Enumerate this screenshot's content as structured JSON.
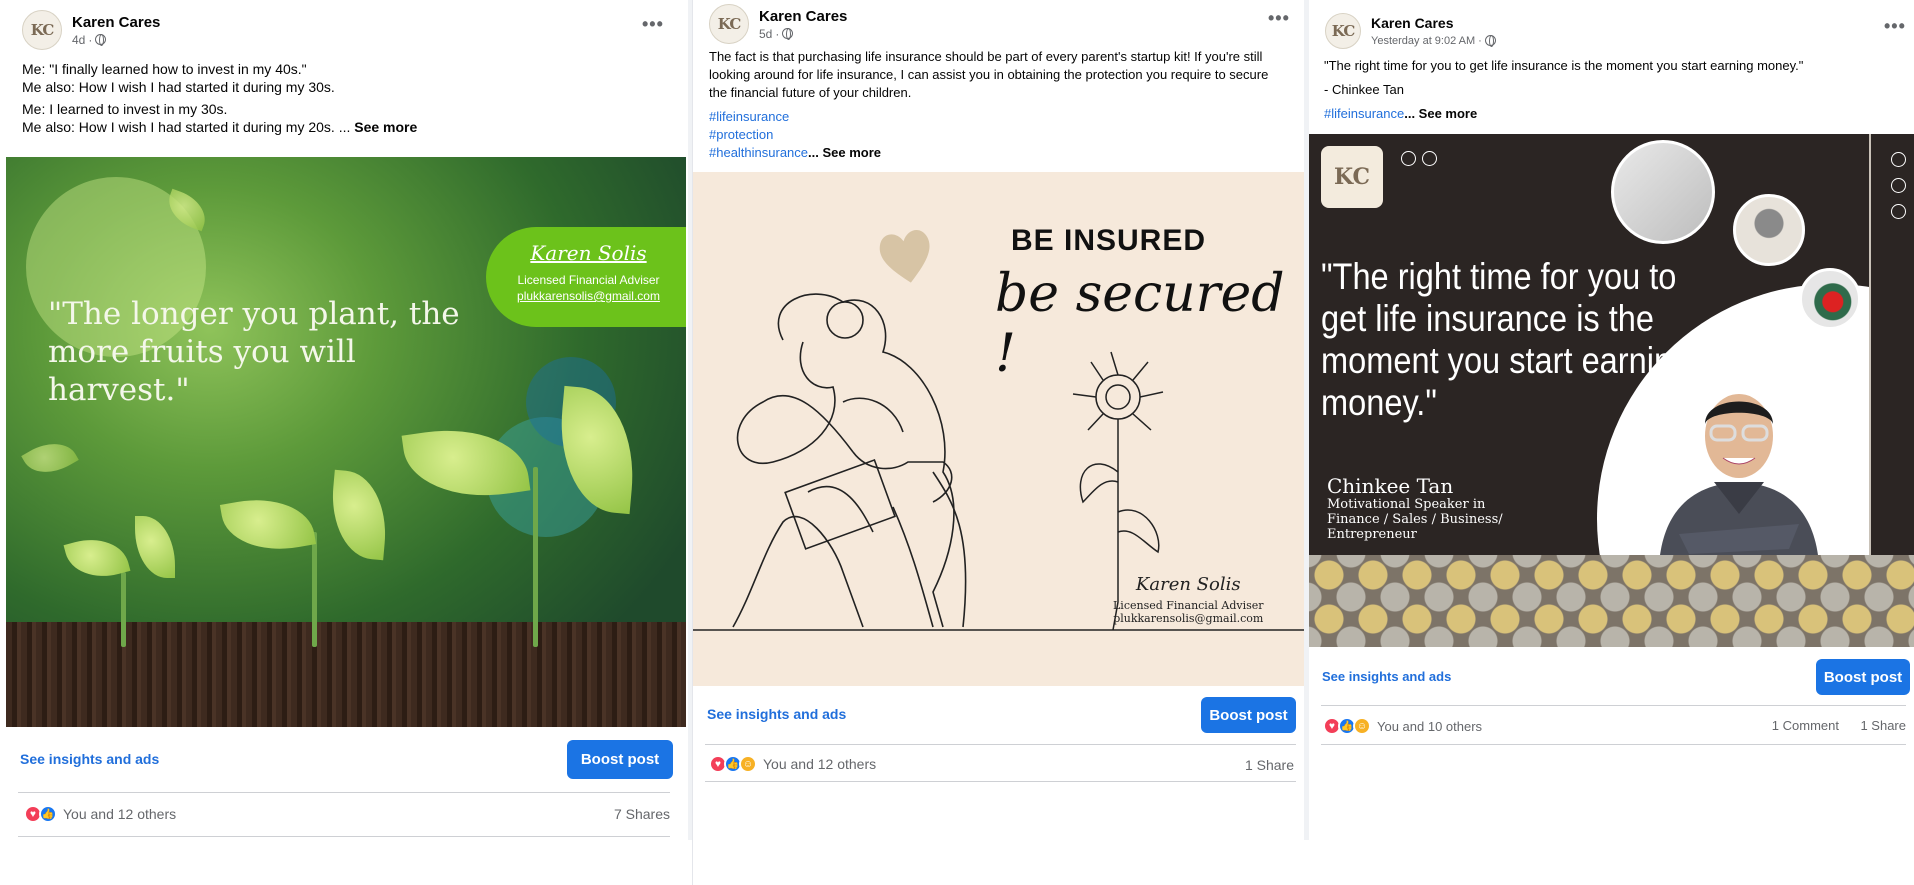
{
  "posts": [
    {
      "author": "Karen Cares",
      "time": "4d",
      "avatar": "KC",
      "text": [
        "Me: \"I finally learned how to invest in my 40s.\"",
        "Me also: How I wish I had started it during my 30s.",
        "Me: I learned to invest in my 30s.",
        "Me also: How I wish I had started it during my 20s. ..."
      ],
      "see_more": "See more",
      "image": {
        "quote": "\"The longer you plant, the more fruits you will harvest.\"",
        "badge_name": "Karen Solis",
        "badge_title": "Licensed Financial Adviser",
        "badge_email": "plukkarensolis@gmail.com"
      },
      "insights": "See insights and ads",
      "boost": "Boost post",
      "reactions_text": "You and 12 others",
      "shares": "7 Shares"
    },
    {
      "author": "Karen Cares",
      "time": "5d",
      "avatar": "KC",
      "text": "The fact is that purchasing life insurance should be part of every parent's startup kit! If you're still looking around for life insurance, I can assist you in obtaining the protection you require to secure the financial future of your children.",
      "hashtags": [
        "#lifeinsurance",
        "#protection",
        "#healthinsurance"
      ],
      "see_more": "... See more",
      "image": {
        "headline": "BE INSURED",
        "script": "be secured !",
        "sig_name": "Karen Solis",
        "sig_title": "Licensed Financial Adviser",
        "sig_email": "plukkarensolis@gmail.com"
      },
      "insights": "See insights and ads",
      "boost": "Boost post",
      "reactions_text": "You and 12 others",
      "shares": "1 Share"
    },
    {
      "author": "Karen Cares",
      "time": "Yesterday at 9:02 AM",
      "avatar": "KC",
      "text": "\"The right time for you to get life insurance is the moment you start earning money.\"",
      "attribution": "- Chinkee Tan",
      "hashtags": [
        "#lifeinsurance"
      ],
      "see_more": "... See more",
      "image": {
        "logo": "KC",
        "quote": "\"The right time for you to get life insurance is the moment you start earning money.\"",
        "speaker": "Chinkee Tan",
        "speaker_title": "Motivational Speaker in Finance / Sales / Business/ Entrepreneur"
      },
      "insights": "See insights and ads",
      "boost": "Boost post",
      "reactions_text": "You and 10 others",
      "comments": "1 Comment",
      "shares": "1 Share"
    }
  ],
  "colors": {
    "link": "#216fdb",
    "boost": "#1b74e4",
    "love": "#f33e58",
    "like": "#1877f2",
    "care": "#f7b125",
    "badge_green": "#6cc21b"
  },
  "icons": [
    "more-options-icon",
    "globe-icon",
    "love-reaction-icon",
    "like-reaction-icon",
    "care-reaction-icon"
  ]
}
